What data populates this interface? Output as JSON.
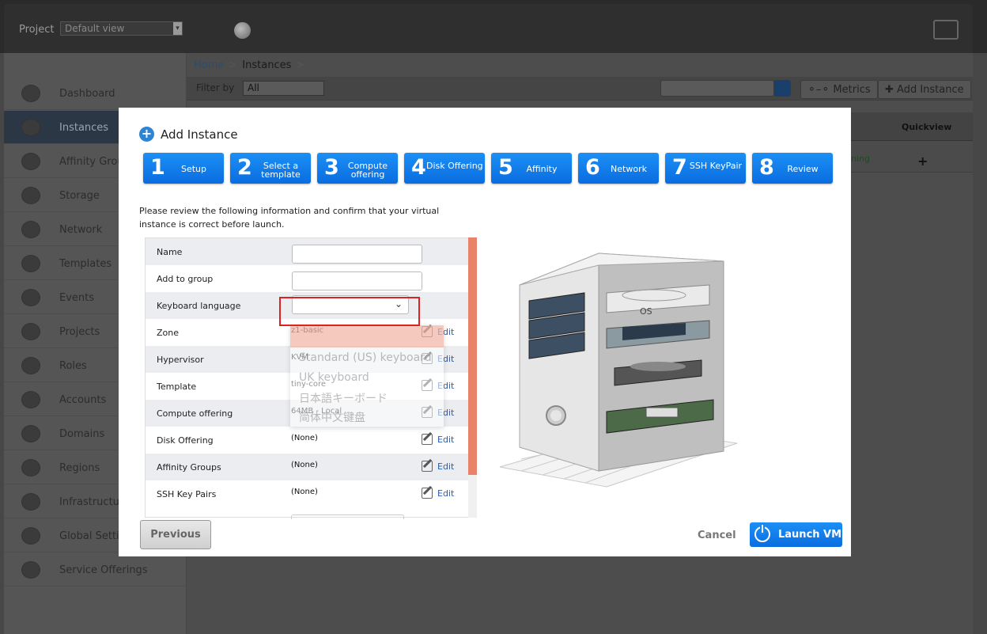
{
  "header": {
    "project_label": "Project",
    "project_value": "Default view"
  },
  "sidebar": {
    "items": [
      {
        "label": "Dashboard",
        "icon": "dashboard-icon"
      },
      {
        "label": "Instances",
        "icon": "cloud-icon",
        "active": true
      },
      {
        "label": "Affinity Grou",
        "icon": "affinity-icon"
      },
      {
        "label": "Storage",
        "icon": "storage-icon"
      },
      {
        "label": "Network",
        "icon": "network-icon"
      },
      {
        "label": "Templates",
        "icon": "templates-icon"
      },
      {
        "label": "Events",
        "icon": "calendar-icon"
      },
      {
        "label": "Projects",
        "icon": "folder-icon"
      },
      {
        "label": "Roles",
        "icon": "roles-icon"
      },
      {
        "label": "Accounts",
        "icon": "user-icon"
      },
      {
        "label": "Domains",
        "icon": "domains-icon"
      },
      {
        "label": "Regions",
        "icon": "globe-icon"
      },
      {
        "label": "Infrastructur",
        "icon": "infrastructure-icon"
      },
      {
        "label": "Global Settin",
        "icon": "globe-icon"
      },
      {
        "label": "Service Offerings",
        "icon": "gear-icon"
      }
    ]
  },
  "breadcrumb": {
    "home": "Home",
    "sep": ">",
    "current": "Instances",
    "sep2": ">"
  },
  "filter": {
    "label": "Filter by",
    "value": "All"
  },
  "toolbar": {
    "metrics": "Metrics",
    "add_instance": "Add Instance"
  },
  "table": {
    "quickview_header": "Quickview",
    "state_fragment": "ning",
    "quickview_plus": "+"
  },
  "dialog": {
    "title": "Add Instance",
    "steps": [
      {
        "num": "1",
        "label": "Setup"
      },
      {
        "num": "2",
        "label": "Select a template"
      },
      {
        "num": "3",
        "label": "Compute offering"
      },
      {
        "num": "4",
        "label": "Disk Offering"
      },
      {
        "num": "5",
        "label": "Affinity"
      },
      {
        "num": "6",
        "label": "Network"
      },
      {
        "num": "7",
        "label": "SSH KeyPair"
      },
      {
        "num": "8",
        "label": "Review"
      }
    ],
    "intro": "Please review the following information and confirm that your virtual instance is correct before launch.",
    "rows": [
      {
        "label": "Name",
        "value": ""
      },
      {
        "label": "Add to group",
        "value": ""
      },
      {
        "label": "Keyboard language",
        "value": ""
      },
      {
        "label": "Zone",
        "value": "z1-basic",
        "edit": "Edit"
      },
      {
        "label": "Hypervisor",
        "value": "KVM",
        "edit": "Edit"
      },
      {
        "label": "Template",
        "value": "tiny-core",
        "edit": "Edit"
      },
      {
        "label": "Compute offering",
        "value": "64MB - Local",
        "edit": "Edit"
      },
      {
        "label": "Disk Offering",
        "value": "(None)",
        "edit": "Edit"
      },
      {
        "label": "Affinity Groups",
        "value": "(None)",
        "edit": "Edit"
      },
      {
        "label": "SSH Key Pairs",
        "value": "(None)",
        "edit": "Edit"
      }
    ],
    "keyboard_options": [
      "Standard (US) keyboard",
      "UK keyboard",
      "日本語キーボード",
      "简体中文键盘"
    ],
    "illustration_os_label": "OS",
    "previous": "Previous",
    "cancel": "Cancel",
    "launch": "Launch VM"
  },
  "colors": {
    "accent_blue": "#1a86ef",
    "scroll_orange": "#e8836a",
    "highlight_red": "#dd2222"
  }
}
